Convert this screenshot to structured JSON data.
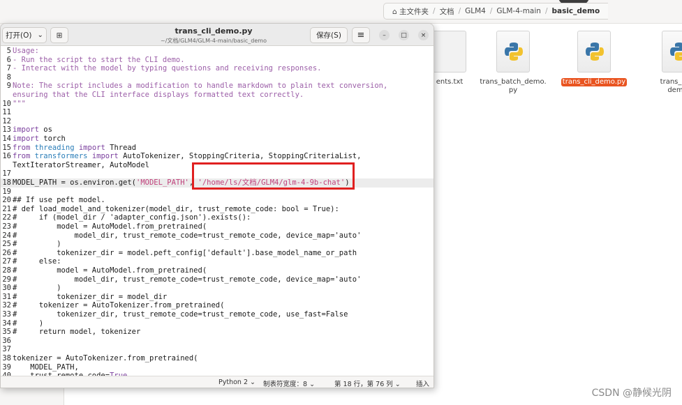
{
  "file_manager": {
    "breadcrumb": [
      "主文件夹",
      "文档",
      "GLM4",
      "GLM-4-main",
      "basic_demo"
    ],
    "files": [
      {
        "name": "ents.txt",
        "kind": "txt",
        "selected": false
      },
      {
        "name_line1": "trans_batch_demo.",
        "name_line2": "py",
        "kind": "py",
        "selected": false
      },
      {
        "name": "trans_cli_demo.py",
        "kind": "py",
        "selected": true
      },
      {
        "name_line1": "trans_cli_v",
        "name_line2": "demo.",
        "kind": "py",
        "selected": false
      }
    ]
  },
  "watermark": "CSDN @静候光阴",
  "editor": {
    "open_label": "打开(O)",
    "title": "trans_cli_demo.py",
    "subtitle": "~/文档/GLM4/GLM-4-main/basic_demo",
    "save_label": "保存(S)",
    "status": {
      "language": "Python 2",
      "tab_width": "制表符宽度：8",
      "position": "第 18 行，第 76 列",
      "mode": "插入"
    },
    "lines": [
      {
        "n": "5",
        "segs": [
          [
            "c",
            "Usage:"
          ]
        ]
      },
      {
        "n": "6",
        "segs": [
          [
            "c",
            "- Run the script to start the CLI demo."
          ]
        ]
      },
      {
        "n": "7",
        "segs": [
          [
            "c",
            "- Interact with the model by typing questions and receiving responses."
          ]
        ]
      },
      {
        "n": "8",
        "segs": [
          [
            "c",
            ""
          ]
        ]
      },
      {
        "n": "9",
        "segs": [
          [
            "c",
            "Note: The script includes a modification to handle markdown to plain text conversion,"
          ]
        ]
      },
      {
        "n": "",
        "segs": [
          [
            "c",
            "ensuring that the CLI interface displays formatted text correctly."
          ]
        ]
      },
      {
        "n": "10",
        "segs": [
          [
            "c",
            "\"\"\""
          ]
        ]
      },
      {
        "n": "11",
        "segs": []
      },
      {
        "n": "12",
        "segs": []
      },
      {
        "n": "13",
        "segs": [
          [
            "k",
            "import"
          ],
          [
            "n",
            " os"
          ]
        ]
      },
      {
        "n": "14",
        "segs": [
          [
            "k",
            "import"
          ],
          [
            "n",
            " torch"
          ]
        ]
      },
      {
        "n": "15",
        "segs": [
          [
            "k",
            "from"
          ],
          [
            "n",
            " "
          ],
          [
            "d",
            "threading"
          ],
          [
            "n",
            " "
          ],
          [
            "k",
            "import"
          ],
          [
            "n",
            " Thread"
          ]
        ]
      },
      {
        "n": "16",
        "segs": [
          [
            "k",
            "from"
          ],
          [
            "n",
            " "
          ],
          [
            "d",
            "transformers"
          ],
          [
            "n",
            " "
          ],
          [
            "k",
            "import"
          ],
          [
            "n",
            " AutoTokenizer, StoppingCriteria, StoppingCriteriaList,"
          ]
        ]
      },
      {
        "n": "",
        "segs": [
          [
            "n",
            "TextIteratorStreamer, AutoModel"
          ]
        ]
      },
      {
        "n": "17",
        "segs": []
      },
      {
        "n": "18",
        "cur": true,
        "segs": [
          [
            "n",
            "MODEL_PATH = os.environ.get("
          ],
          [
            "s",
            "'MODEL_PATH'"
          ],
          [
            "n",
            ", "
          ],
          [
            "s",
            "'/home/ls/文档/GLM4/glm-4-9b-chat'"
          ],
          [
            "n",
            ")"
          ]
        ]
      },
      {
        "n": "19",
        "segs": []
      },
      {
        "n": "20",
        "segs": [
          [
            "n",
            "## If use peft model."
          ]
        ]
      },
      {
        "n": "21",
        "segs": [
          [
            "n",
            "# def load_model_and_tokenizer(model_dir, trust_remote_code: bool = True):"
          ]
        ]
      },
      {
        "n": "22",
        "segs": [
          [
            "n",
            "#     if (model_dir / 'adapter_config.json').exists():"
          ]
        ]
      },
      {
        "n": "23",
        "segs": [
          [
            "n",
            "#         model = AutoModel.from_pretrained("
          ]
        ]
      },
      {
        "n": "24",
        "segs": [
          [
            "n",
            "#             model_dir, trust_remote_code=trust_remote_code, device_map='auto'"
          ]
        ]
      },
      {
        "n": "25",
        "segs": [
          [
            "n",
            "#         )"
          ]
        ]
      },
      {
        "n": "26",
        "segs": [
          [
            "n",
            "#         tokenizer_dir = model.peft_config['default'].base_model_name_or_path"
          ]
        ]
      },
      {
        "n": "27",
        "segs": [
          [
            "n",
            "#     else:"
          ]
        ]
      },
      {
        "n": "28",
        "segs": [
          [
            "n",
            "#         model = AutoModel.from_pretrained("
          ]
        ]
      },
      {
        "n": "29",
        "segs": [
          [
            "n",
            "#             model_dir, trust_remote_code=trust_remote_code, device_map='auto'"
          ]
        ]
      },
      {
        "n": "30",
        "segs": [
          [
            "n",
            "#         )"
          ]
        ]
      },
      {
        "n": "31",
        "segs": [
          [
            "n",
            "#         tokenizer_dir = model_dir"
          ]
        ]
      },
      {
        "n": "32",
        "segs": [
          [
            "n",
            "#     tokenizer = AutoTokenizer.from_pretrained("
          ]
        ]
      },
      {
        "n": "33",
        "segs": [
          [
            "n",
            "#         tokenizer_dir, trust_remote_code=trust_remote_code, use_fast=False"
          ]
        ]
      },
      {
        "n": "34",
        "segs": [
          [
            "n",
            "#     )"
          ]
        ]
      },
      {
        "n": "35",
        "segs": [
          [
            "n",
            "#     return model, tokenizer"
          ]
        ]
      },
      {
        "n": "36",
        "segs": []
      },
      {
        "n": "37",
        "segs": []
      },
      {
        "n": "38",
        "segs": [
          [
            "n",
            "tokenizer = AutoTokenizer.from_pretrained("
          ]
        ]
      },
      {
        "n": "39",
        "segs": [
          [
            "n",
            "    MODEL_PATH,"
          ]
        ]
      },
      {
        "n": "40",
        "segs": [
          [
            "n",
            "    trust_remote_code="
          ],
          [
            "b",
            "True"
          ],
          [
            "n",
            ","
          ]
        ]
      }
    ]
  }
}
